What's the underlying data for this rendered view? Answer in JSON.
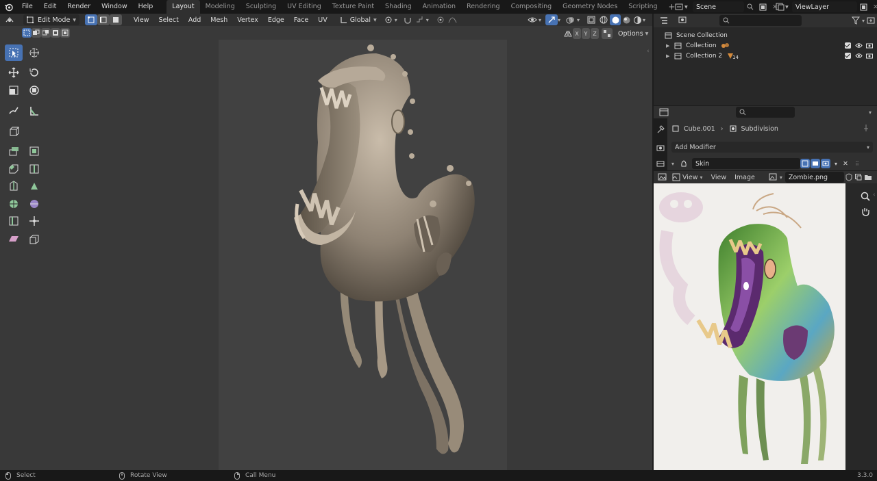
{
  "topbar": {
    "menus": [
      "File",
      "Edit",
      "Render",
      "Window",
      "Help"
    ],
    "workspaces": [
      "Layout",
      "Modeling",
      "Sculpting",
      "UV Editing",
      "Texture Paint",
      "Shading",
      "Animation",
      "Rendering",
      "Compositing",
      "Geometry Nodes",
      "Scripting"
    ],
    "active_workspace": "Layout",
    "scene": "Scene",
    "view_layer": "ViewLayer"
  },
  "viewport": {
    "mode": "Edit Mode",
    "menus": [
      "View",
      "Select",
      "Add",
      "Mesh",
      "Vertex",
      "Edge",
      "Face",
      "UV"
    ],
    "orientation": "Global",
    "axes": [
      "X",
      "Y",
      "Z"
    ],
    "options_label": "Options"
  },
  "outliner": {
    "root": "Scene Collection",
    "items": [
      {
        "label": "Collection"
      },
      {
        "label": "Collection 2",
        "badge": "14"
      }
    ]
  },
  "properties": {
    "object": "Cube.001",
    "modifier_name": "Subdivision",
    "add_modifier": "Add Modifier",
    "skin_modifier": "Skin"
  },
  "image_editor": {
    "menus": [
      "View",
      "View",
      "Image"
    ],
    "image_name": "Zombie.png"
  },
  "statusbar": {
    "select": "Select",
    "rotate": "Rotate View",
    "call_menu": "Call Menu",
    "version": "3.3.0"
  },
  "colors": {
    "accent": "#4772b3",
    "viewport_bg": "#393939",
    "camera_bg": "#414141"
  }
}
